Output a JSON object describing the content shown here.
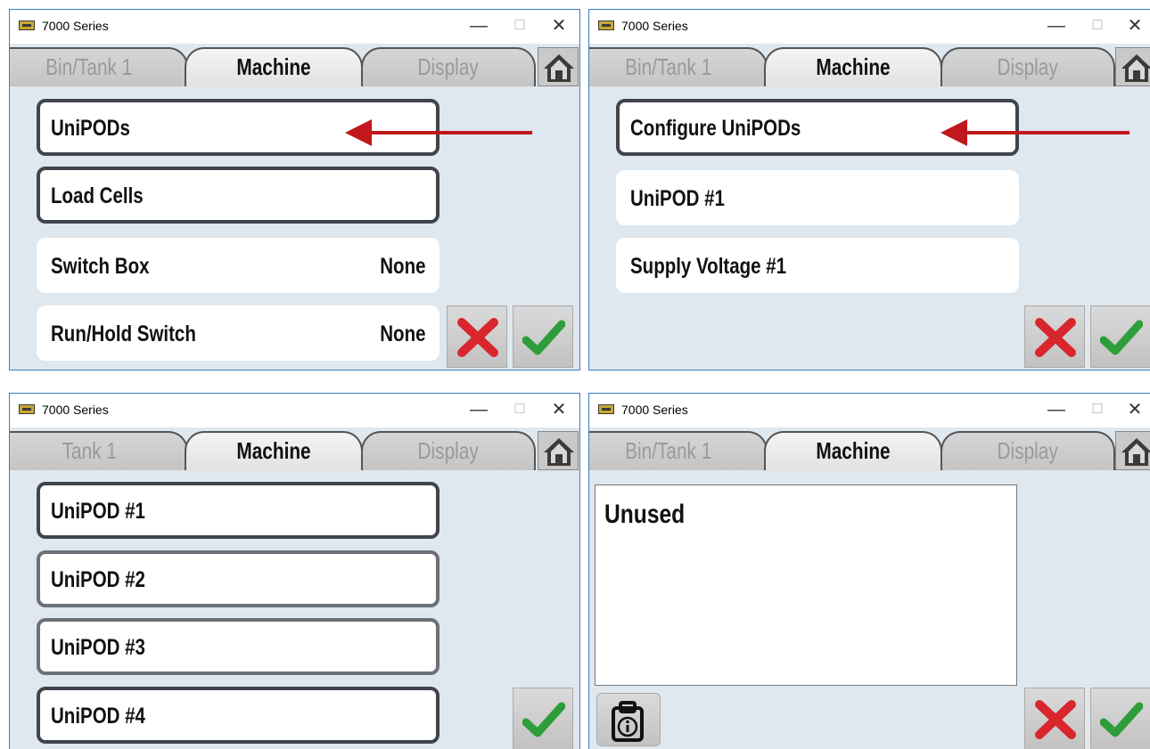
{
  "app_title": "7000 Series",
  "window_controls": {
    "minimize": "—",
    "maximize": "☐",
    "close": "✕"
  },
  "panels": [
    {
      "tabs": [
        "Bin/Tank 1",
        "Machine",
        "Display"
      ],
      "active_tab": "Machine",
      "items": [
        {
          "label": "UniPODs",
          "value": ""
        },
        {
          "label": "Load Cells",
          "value": ""
        },
        {
          "label": "Switch Box",
          "value": "None"
        },
        {
          "label": "Run/Hold Switch",
          "value": "None"
        }
      ]
    },
    {
      "tabs": [
        "Bin/Tank 1",
        "Machine",
        "Display"
      ],
      "active_tab": "Machine",
      "items": [
        {
          "label": "Configure UniPODs"
        },
        {
          "label": "UniPOD #1"
        },
        {
          "label": "Supply Voltage #1"
        }
      ]
    },
    {
      "tabs": [
        "Tank 1",
        "Machine",
        "Display"
      ],
      "active_tab": "Machine",
      "items": [
        {
          "label": "UniPOD #1"
        },
        {
          "label": "UniPOD #2"
        },
        {
          "label": "UniPOD #3"
        },
        {
          "label": "UniPOD #4"
        }
      ]
    },
    {
      "tabs": [
        "Bin/Tank 1",
        "Machine",
        "Display"
      ],
      "active_tab": "Machine",
      "text_value": "Unused"
    }
  ],
  "icons": {
    "home": "home-icon",
    "cancel": "red-x-icon",
    "accept": "green-check-icon",
    "info": "clipboard-info-icon",
    "annotation": "red-arrow"
  },
  "colors": {
    "window_border": "#3c7ec0",
    "panel_bg": "#dfe7ef",
    "arrow": "#c0181c",
    "cancel_red": "#d8262c",
    "accept_green": "#2e9d3a"
  }
}
